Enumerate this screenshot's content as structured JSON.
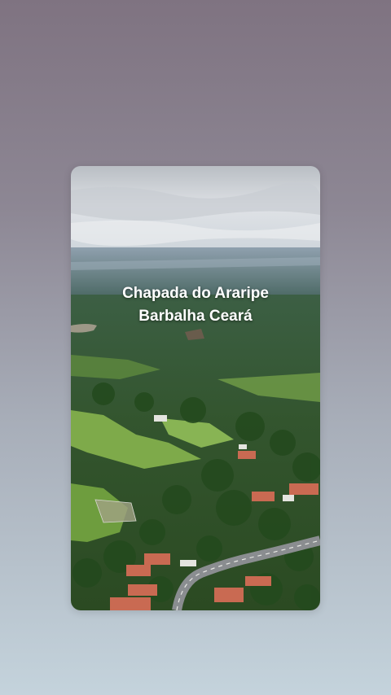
{
  "photo": {
    "caption_line1": "Chapada do Araripe",
    "caption_line2": "Barbalha Ceará"
  },
  "colors": {
    "background_top": "#7f7381",
    "background_bottom": "#c4d3dc",
    "caption_text": "#ffffff"
  }
}
